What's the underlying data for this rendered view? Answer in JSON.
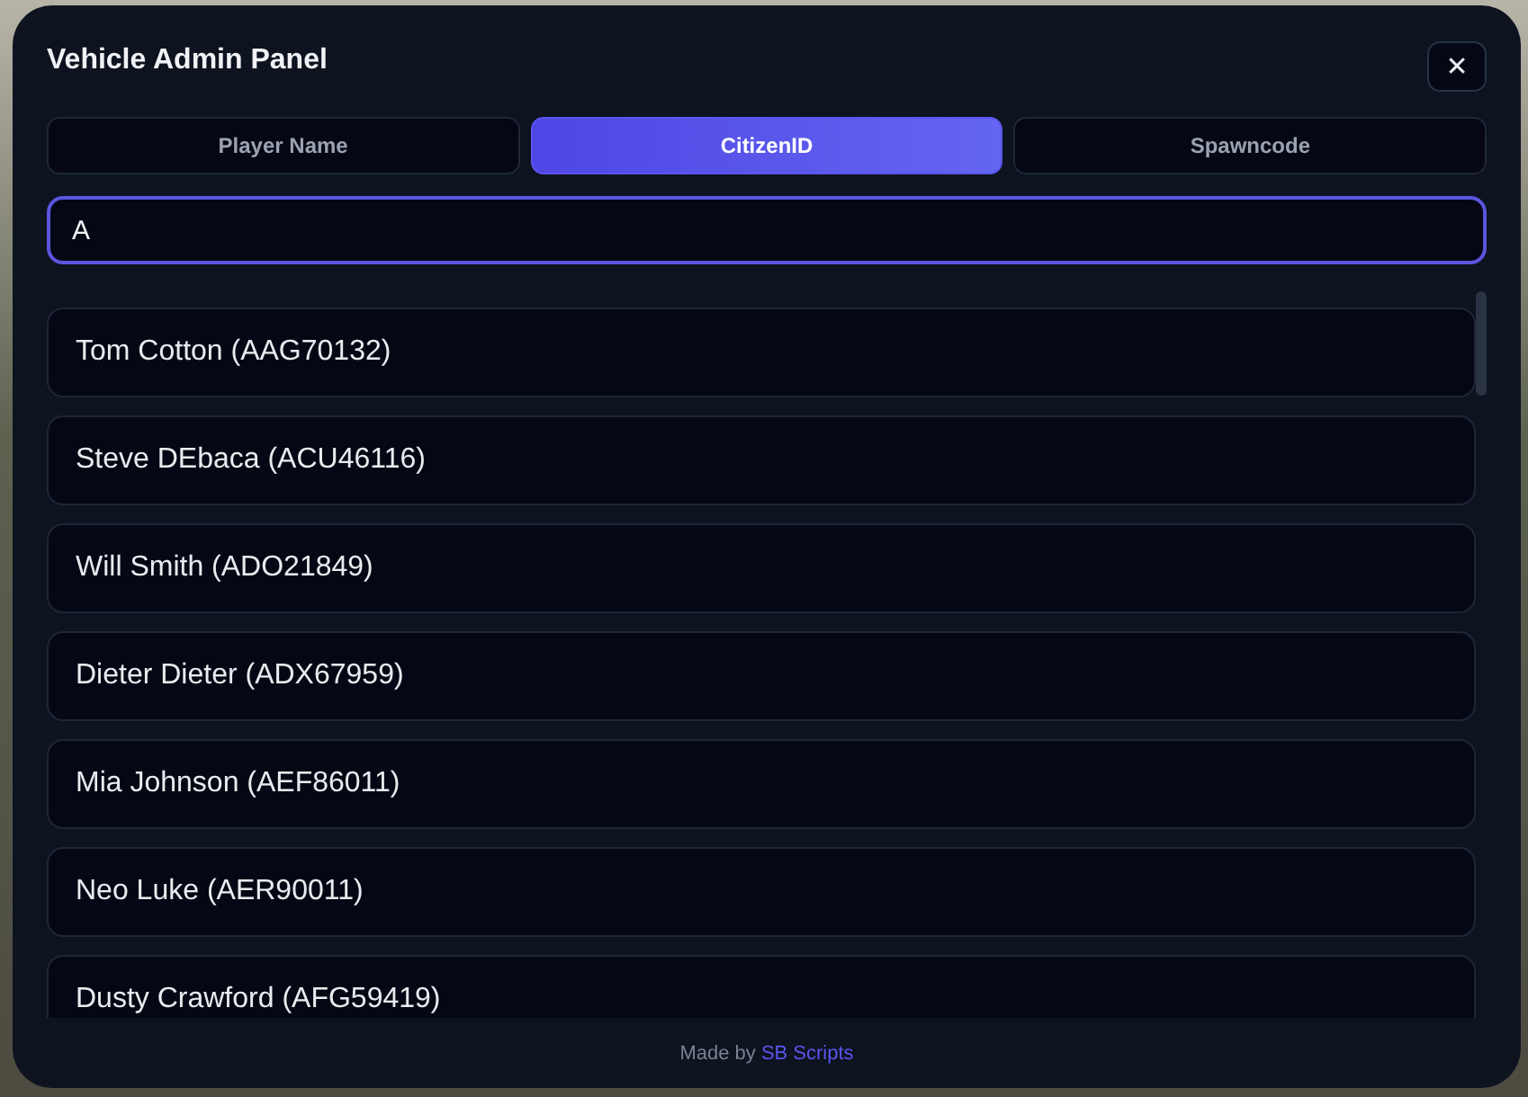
{
  "window": {
    "title": "Vehicle Admin Panel"
  },
  "close_button": {
    "label": "✕"
  },
  "tabs": [
    {
      "label": "Player Name",
      "selected": false
    },
    {
      "label": "CitizenID",
      "selected": true
    },
    {
      "label": "Spawncode",
      "selected": false
    }
  ],
  "search": {
    "value": "A"
  },
  "results": [
    "Tom Cotton (AAG70132)",
    "Steve DEbaca (ACU46116)",
    "Will Smith (ADO21849)",
    "Dieter Dieter (ADX67959)",
    "Mia Johnson (AEF86011)",
    "Neo Luke (AER90011)",
    "Dusty Crawford (AFG59419)"
  ],
  "footer": {
    "text": "Made by",
    "link": "SB Scripts"
  }
}
